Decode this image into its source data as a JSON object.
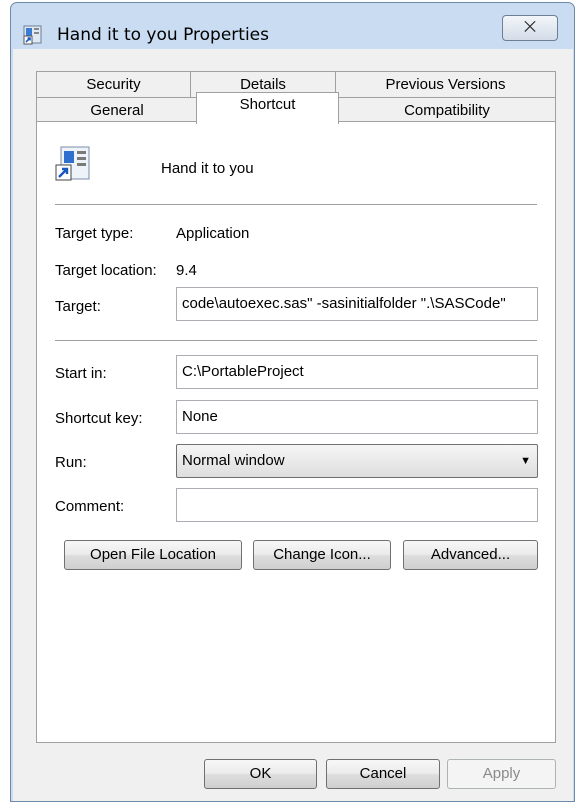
{
  "window": {
    "title": "Hand it to you Properties",
    "close_glyph": "⨉"
  },
  "tabs": {
    "row_back": [
      "Security",
      "Details",
      "Previous Versions"
    ],
    "row_front": [
      "General",
      "Shortcut",
      "Compatibility"
    ],
    "active": "Shortcut"
  },
  "shortcut": {
    "name": "Hand it to you",
    "target_type_label": "Target type:",
    "target_type_value": "Application",
    "target_location_label": "Target location:",
    "target_location_value": "9.4",
    "target_label": "Target:",
    "target_value": "code\\autoexec.sas\" -sasinitialfolder \".\\SASCode\"",
    "start_in_label": "Start in:",
    "start_in_value": "C:\\PortableProject",
    "shortcut_key_label": "Shortcut key:",
    "shortcut_key_value": "None",
    "run_label": "Run:",
    "run_value": "Normal window",
    "comment_label": "Comment:",
    "comment_value": "",
    "open_file_location_label": "Open File Location",
    "change_icon_label": "Change Icon...",
    "advanced_label": "Advanced..."
  },
  "footer": {
    "ok_label": "OK",
    "cancel_label": "Cancel",
    "apply_label": "Apply"
  },
  "colors": {
    "frame": "#c9dcf1",
    "client": "#f0f0f0",
    "panel": "#ffffff"
  }
}
